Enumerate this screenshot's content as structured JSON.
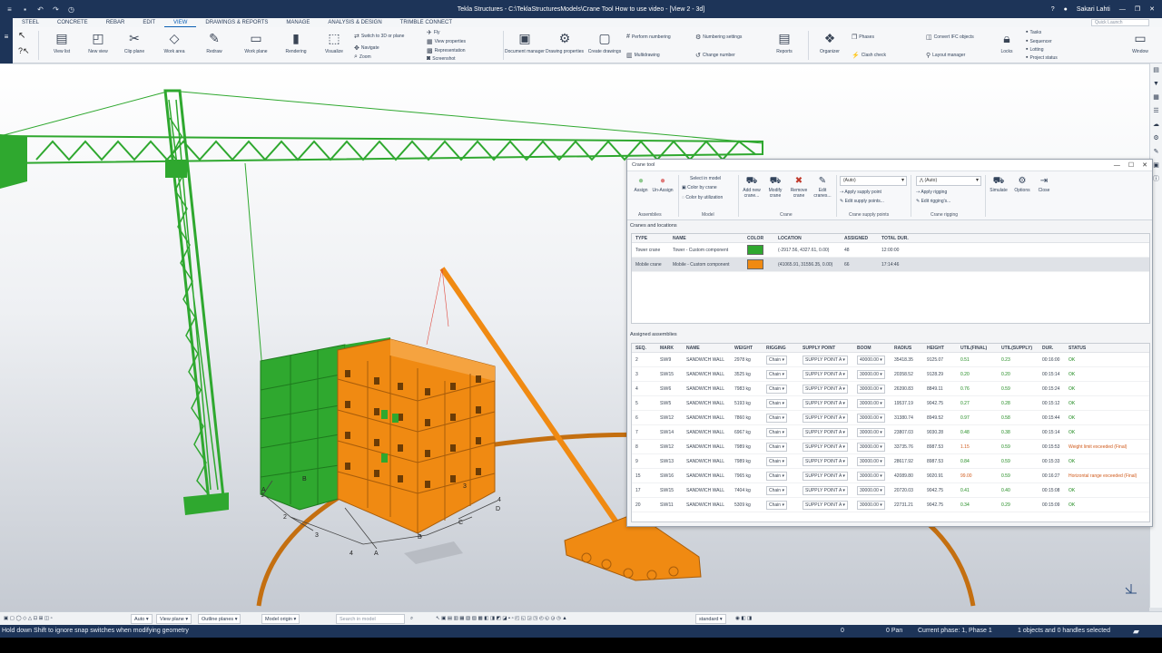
{
  "titlebar": {
    "title": "Tekla Structures - C:\\TeklaStructuresModels\\Crane Tool How to use video - [View 2 - 3d]",
    "user": "Sakari Lahti",
    "help_icon": "?",
    "quick_launch_placeholder": "Quick Launch"
  },
  "menu": {
    "tabs": [
      "STEEL",
      "CONCRETE",
      "REBAR",
      "EDIT",
      "VIEW",
      "DRAWINGS & REPORTS",
      "MANAGE",
      "ANALYSIS & DESIGN",
      "TRIMBLE CONNECT"
    ],
    "active": "VIEW"
  },
  "ribbon": {
    "view_list": "View list",
    "new_view": "New view",
    "clip_plane": "Clip plane",
    "work_area": "Work area",
    "redraw": "Redraw",
    "work_plane": "Work plane",
    "rendering": "Rendering",
    "visualize": "Visualize",
    "switch_3d": "Switch to 3D or plane",
    "navigate": "Navigate",
    "zoom": "Zoom",
    "fly": "Fly",
    "view_properties": "View properties",
    "representation": "Representation",
    "screenshot": "Screenshot",
    "document_manager": "Document manager",
    "drawing_properties": "Drawing properties",
    "create_drawings": "Create drawings",
    "perform_numbering": "Perform numbering",
    "multidrawing": "Multidrawing",
    "numbering_settings": "Numbering settings",
    "change_number": "Change number",
    "reports": "Reports",
    "organizer": "Organizer",
    "phases": "Phases",
    "clash_check": "Clash check",
    "convert_ifc": "Convert IFC objects",
    "layout_manager": "Layout manager",
    "locks": "Locks",
    "tasks": "Tasks",
    "sequencer": "Sequencer",
    "lotting": "Lotting",
    "project_status": "Project status",
    "window": "Window"
  },
  "crane_tool": {
    "title": "Crane tool",
    "ribbon": {
      "assign": "Assign",
      "unassign": "Un-Assign",
      "assemblies_group": "Assemblies",
      "select_in_model": "Select in model",
      "color_by_crane": "Color by crane",
      "color_by_utilization": "Color by utilization",
      "model_group": "Model",
      "add_new_crane": "Add new crane...",
      "modify_crane": "Modify crane",
      "remove_crane": "Remove crane",
      "edit_cranes": "Edit cranes...",
      "crane_group": "Crane",
      "supply_select": "(Auto)",
      "apply_supply_point": "Apply supply point",
      "edit_supply_points": "Edit supply points...",
      "supply_group": "Crane supply points",
      "rigging_select": "(Auto)",
      "apply_rigging": "Apply rigging",
      "edit_rigging": "Edit rigging's...",
      "rigging_group": "Crane rigging",
      "simulate": "Simulate",
      "options": "Options",
      "close": "Close"
    },
    "cranes_section": "Cranes and locations",
    "cranes_columns": [
      "TYPE",
      "NAME",
      "COLOR",
      "LOCATION",
      "ASSIGNED",
      "TOTAL DUR."
    ],
    "cranes": [
      {
        "type": "Tower crane",
        "name": "Tower - Custom component",
        "color": "#2fa82f",
        "location": "(-2917.56, 4327.61, 0.00)",
        "assigned": "48",
        "duration": "12:00:00"
      },
      {
        "type": "Mobile crane",
        "name": "Mobile - Custom component",
        "color": "#f08a12",
        "location": "(41065.91, 31556.35, 0.00)",
        "assigned": "66",
        "duration": "17:14:46"
      }
    ],
    "assigned_section": "Assigned assemblies",
    "assigned_columns": [
      "SEQ.",
      "MARK",
      "NAME",
      "WEIGHT",
      "RIGGING",
      "SUPPLY POINT",
      "BOOM",
      "RADIUS",
      "HEIGHT",
      "UTIL(FINAL)",
      "UTIL(SUPPLY)",
      "DUR.",
      "STATUS"
    ],
    "assigned": [
      {
        "seq": "2",
        "mark": "SW/9",
        "name": "SANDWICH WALL",
        "weight": "2978 kg",
        "rigging": "Chain",
        "supply": "SUPPLY POINT A",
        "boom": "40000.00",
        "radius": "35418.35",
        "height": "9125.07",
        "util_final": "0.51",
        "util_supply": "0.23",
        "dur": "00:16:00",
        "status": "OK",
        "bad": false
      },
      {
        "seq": "3",
        "mark": "SW/15",
        "name": "SANDWICH WALL",
        "weight": "3525 kg",
        "rigging": "Chain",
        "supply": "SUPPLY POINT A",
        "boom": "30000.00",
        "radius": "20358.52",
        "height": "9128.29",
        "util_final": "0.20",
        "util_supply": "0.20",
        "dur": "00:15:14",
        "status": "OK",
        "bad": false
      },
      {
        "seq": "4",
        "mark": "SW/6",
        "name": "SANDWICH WALL",
        "weight": "7983 kg",
        "rigging": "Chain",
        "supply": "SUPPLY POINT A",
        "boom": "30000.00",
        "radius": "26390.83",
        "height": "8849.11",
        "util_final": "0.76",
        "util_supply": "0.59",
        "dur": "00:15:24",
        "status": "OK",
        "bad": false
      },
      {
        "seq": "5",
        "mark": "SW/5",
        "name": "SANDWICH WALL",
        "weight": "5193 kg",
        "rigging": "Chain",
        "supply": "SUPPLY POINT A",
        "boom": "30000.00",
        "radius": "19537.19",
        "height": "9042.75",
        "util_final": "0.27",
        "util_supply": "0.28",
        "dur": "00:15:12",
        "status": "OK",
        "bad": false
      },
      {
        "seq": "6",
        "mark": "SW/12",
        "name": "SANDWICH WALL",
        "weight": "7860 kg",
        "rigging": "Chain",
        "supply": "SUPPLY POINT A",
        "boom": "30000.00",
        "radius": "31380.74",
        "height": "8949.52",
        "util_final": "0.97",
        "util_supply": "0.58",
        "dur": "00:15:44",
        "status": "OK",
        "bad": false
      },
      {
        "seq": "7",
        "mark": "SW/14",
        "name": "SANDWICH WALL",
        "weight": "6967 kg",
        "rigging": "Chain",
        "supply": "SUPPLY POINT A",
        "boom": "30000.00",
        "radius": "23807.03",
        "height": "9030.28",
        "util_final": "0.48",
        "util_supply": "0.38",
        "dur": "00:15:14",
        "status": "OK",
        "bad": false
      },
      {
        "seq": "8",
        "mark": "SW/12",
        "name": "SANDWICH WALL",
        "weight": "7989 kg",
        "rigging": "Chain",
        "supply": "SUPPLY POINT A",
        "boom": "30000.00",
        "radius": "33735.76",
        "height": "8987.53",
        "util_final": "1.15",
        "util_supply": "0.59",
        "dur": "00:15:53",
        "status": "Weight limit exceeded (Final)",
        "bad": true
      },
      {
        "seq": "9",
        "mark": "SW/13",
        "name": "SANDWICH WALL",
        "weight": "7989 kg",
        "rigging": "Chain",
        "supply": "SUPPLY POINT A",
        "boom": "30000.00",
        "radius": "28617.92",
        "height": "8987.53",
        "util_final": "0.84",
        "util_supply": "0.59",
        "dur": "00:15:33",
        "status": "OK",
        "bad": false
      },
      {
        "seq": "15",
        "mark": "SW/16",
        "name": "SANDWICH WALL",
        "weight": "7965 kg",
        "rigging": "Chain",
        "supply": "SUPPLY POINT A",
        "boom": "30000.00",
        "radius": "42089.80",
        "height": "9020.91",
        "util_final": "99.00",
        "util_supply": "0.59",
        "dur": "00:16:27",
        "status": "Horizontal range exceeded (Final)",
        "bad": true
      },
      {
        "seq": "17",
        "mark": "SW/15",
        "name": "SANDWICH WALL",
        "weight": "7404 kg",
        "rigging": "Chain",
        "supply": "SUPPLY POINT A",
        "boom": "30000.00",
        "radius": "20720.03",
        "height": "9042.75",
        "util_final": "0.41",
        "util_supply": "0.40",
        "dur": "00:15:08",
        "status": "OK",
        "bad": false
      },
      {
        "seq": "20",
        "mark": "SW/11",
        "name": "SANDWICH WALL",
        "weight": "5309 kg",
        "rigging": "Chain",
        "supply": "SUPPLY POINT A",
        "boom": "30000.00",
        "radius": "22731.21",
        "height": "9042.75",
        "util_final": "0.34",
        "util_supply": "0.29",
        "dur": "00:15:09",
        "status": "OK",
        "bad": false
      }
    ]
  },
  "model_labels": {
    "grid_numbers": [
      "1",
      "2",
      "3",
      "4"
    ],
    "grid_letters": [
      "A",
      "B",
      "C",
      "D"
    ]
  },
  "bottombar": {
    "auto": "Auto",
    "view_plane": "View plane",
    "outline_planes": "Outline planes",
    "model_origin": "Model origin",
    "search_placeholder": "Search in model",
    "standard": "standard"
  },
  "status": {
    "hint": "Hold down Shift to ignore snap switches when modifying geometry",
    "zero": "0",
    "pan": "0 Pan",
    "phase": "Current phase: 1, Phase 1",
    "selection": "1 objects and 0 handles selected"
  },
  "colors": {
    "tower": "#2fa82f",
    "mobile": "#f08a12",
    "chrome": "#1d3458"
  }
}
